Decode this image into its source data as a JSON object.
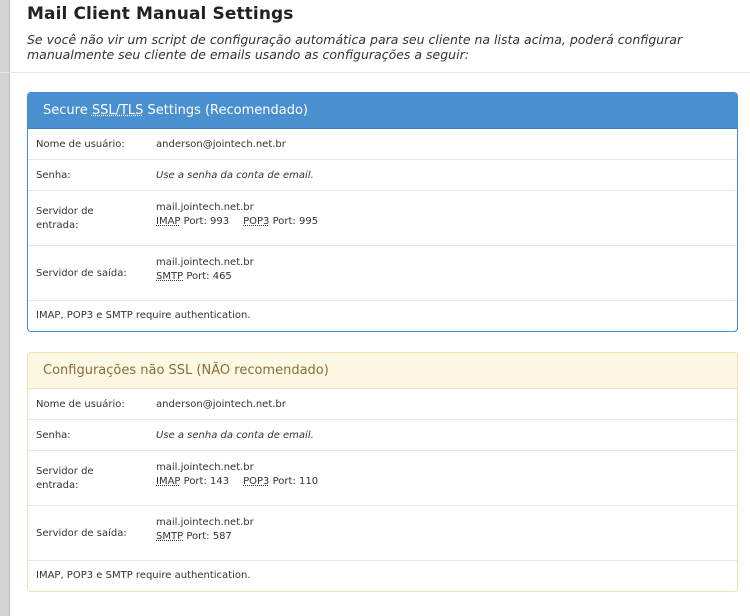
{
  "page": {
    "title": "Mail Client Manual Settings",
    "intro": "Se você não vir um script de configuração automática para seu cliente na lista acima, poderá configurar manualmente seu cliente de emails usando as configurações a seguir:"
  },
  "labels": {
    "username": "Nome de usuário:",
    "password": "Senha:",
    "incoming_line1": "Servidor de",
    "incoming_line2": "entrada:",
    "outgoing": "Servidor de saída:",
    "port_suffix": "Port:"
  },
  "ssl": {
    "heading_pre": "Secure ",
    "heading_abbr": "SSL/TLS",
    "heading_post": " Settings (Recomendado)",
    "username": "anderson@jointech.net.br",
    "password": "Use a senha da conta de email.",
    "incoming_host": "mail.jointech.net.br",
    "imap_label": "IMAP",
    "imap_port": "993",
    "pop3_label": "POP3",
    "pop3_port": "995",
    "outgoing_host": "mail.jointech.net.br",
    "smtp_label": "SMTP",
    "smtp_port": "465",
    "note": "IMAP, POP3 e SMTP require authentication."
  },
  "nossl": {
    "heading": "Configurações não SSL (NÃO recomendado)",
    "username": "anderson@jointech.net.br",
    "password": "Use a senha da conta de email.",
    "incoming_host": "mail.jointech.net.br",
    "imap_label": "IMAP",
    "imap_port": "143",
    "pop3_label": "POP3",
    "pop3_port": "110",
    "outgoing_host": "mail.jointech.net.br",
    "smtp_label": "SMTP",
    "smtp_port": "587",
    "note": "IMAP, POP3 e SMTP require authentication."
  },
  "colors": {
    "ssl_heading_bg": "#4a90d0",
    "nossl_heading_bg": "#fcf8e3",
    "nossl_heading_text": "#8a6d3b"
  }
}
